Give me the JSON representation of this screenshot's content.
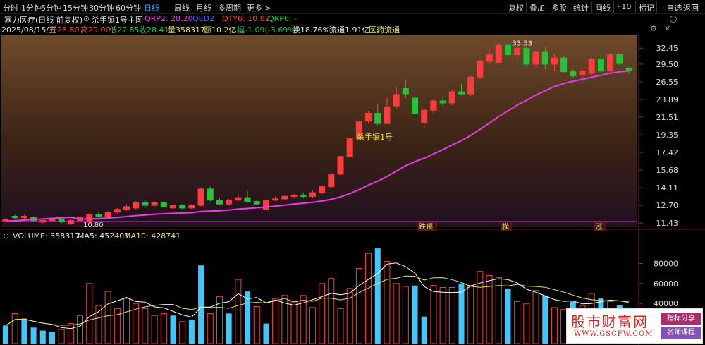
{
  "toolbar": {
    "periods": [
      {
        "label": "分时",
        "active": false
      },
      {
        "label": "1分钟",
        "active": false
      },
      {
        "label": "5分钟",
        "active": false
      },
      {
        "label": "15分钟",
        "active": false
      },
      {
        "label": "30分钟",
        "active": false
      },
      {
        "label": "60分钟",
        "active": false
      },
      {
        "label": "日线",
        "active": true
      },
      {
        "label": "周线",
        "active": false
      },
      {
        "label": "月线",
        "active": false
      },
      {
        "label": "多周期",
        "active": false
      },
      {
        "label": "更多 >",
        "active": false
      }
    ],
    "right_buttons": [
      "复权",
      "叠加",
      "多股",
      "统计",
      "画线",
      "F10",
      "标记",
      "+自选",
      "返回"
    ]
  },
  "header": {
    "stock_name": "塞力医疗(日线 前复权)",
    "indicator": "杀手锏1号主图",
    "qrp2_label": "QRP2: 28.20",
    "qed2_label": "QED2",
    "qty6_label": "QTY6: 10.82",
    "qrp6_label": "QRP6: -",
    "date": "2025/08/15/五",
    "open": "开28.80",
    "high": "高29.00",
    "low": "低27.85",
    "close": "收28.41",
    "volume": "量358317",
    "amount": "额10.2亿",
    "change": "幅-1.09(-3.69%)",
    "turnover": "换18.76%",
    "float": "流通1.91亿",
    "sector": "医药流通"
  },
  "colors": {
    "up": "#ff3b3b",
    "down": "#3fc8ff",
    "green_candle": "#22c43a",
    "ma_line": "#e63ce6",
    "ma5": "#ffffff",
    "ma10": "#e8e060"
  },
  "chart_data": {
    "type": "candlestick",
    "price_axis_ticks": [
      "32.45",
      "29.50",
      "26.55",
      "23.89",
      "21.51",
      "19.35",
      "17.42",
      "15.68",
      "14.11",
      "12.70",
      "11.43"
    ],
    "annotation_high": "33.53",
    "annotation_low": "10.80",
    "signal_label": "杀手锏1号",
    "bottom_markers": [
      "跌预",
      "横",
      "涨"
    ],
    "candles": [
      {
        "o": 11.6,
        "c": 11.7,
        "h": 11.8,
        "l": 11.5
      },
      {
        "o": 11.9,
        "c": 11.8,
        "h": 12.0,
        "l": 11.7
      },
      {
        "o": 11.8,
        "c": 11.9,
        "h": 12.0,
        "l": 11.7
      },
      {
        "o": 11.8,
        "c": 11.6,
        "h": 11.9,
        "l": 11.5
      },
      {
        "o": 11.5,
        "c": 11.6,
        "h": 11.7,
        "l": 11.4
      },
      {
        "o": 11.6,
        "c": 11.7,
        "h": 11.8,
        "l": 11.5
      },
      {
        "o": 11.7,
        "c": 11.5,
        "h": 11.8,
        "l": 11.4
      },
      {
        "o": 11.4,
        "c": 11.6,
        "h": 11.7,
        "l": 11.3
      },
      {
        "o": 11.6,
        "c": 11.8,
        "h": 11.9,
        "l": 11.5
      },
      {
        "o": 11.5,
        "c": 12.0,
        "h": 12.1,
        "l": 11.4
      },
      {
        "o": 12.0,
        "c": 11.9,
        "h": 12.2,
        "l": 11.8
      },
      {
        "o": 11.9,
        "c": 12.2,
        "h": 12.3,
        "l": 11.8
      },
      {
        "o": 12.2,
        "c": 12.4,
        "h": 12.5,
        "l": 12.1
      },
      {
        "o": 12.4,
        "c": 12.6,
        "h": 12.8,
        "l": 12.3
      },
      {
        "o": 12.5,
        "c": 12.9,
        "h": 13.0,
        "l": 12.4
      },
      {
        "o": 12.9,
        "c": 12.7,
        "h": 13.1,
        "l": 12.5
      },
      {
        "o": 12.7,
        "c": 12.9,
        "h": 13.0,
        "l": 12.6
      },
      {
        "o": 12.9,
        "c": 12.6,
        "h": 13.0,
        "l": 12.5
      },
      {
        "o": 12.5,
        "c": 12.7,
        "h": 12.8,
        "l": 12.4
      },
      {
        "o": 12.7,
        "c": 12.5,
        "h": 12.8,
        "l": 12.4
      },
      {
        "o": 12.5,
        "c": 12.7,
        "h": 12.8,
        "l": 12.4
      },
      {
        "o": 12.7,
        "c": 14.0,
        "h": 14.1,
        "l": 12.6
      },
      {
        "o": 14.0,
        "c": 13.1,
        "h": 14.2,
        "l": 13.0
      },
      {
        "o": 13.1,
        "c": 12.8,
        "h": 13.3,
        "l": 12.7
      },
      {
        "o": 12.8,
        "c": 13.1,
        "h": 13.2,
        "l": 12.7
      },
      {
        "o": 13.1,
        "c": 13.3,
        "h": 13.6,
        "l": 13.0
      },
      {
        "o": 13.3,
        "c": 13.0,
        "h": 13.8,
        "l": 12.9
      },
      {
        "o": 13.0,
        "c": 12.8,
        "h": 13.1,
        "l": 12.7
      },
      {
        "o": 12.4,
        "c": 13.1,
        "h": 13.2,
        "l": 12.2
      },
      {
        "o": 13.1,
        "c": 13.2,
        "h": 13.4,
        "l": 13.0
      },
      {
        "o": 13.2,
        "c": 13.4,
        "h": 13.5,
        "l": 13.1
      },
      {
        "o": 13.4,
        "c": 13.5,
        "h": 13.6,
        "l": 13.3
      },
      {
        "o": 13.5,
        "c": 13.4,
        "h": 13.7,
        "l": 13.3
      },
      {
        "o": 13.4,
        "c": 13.7,
        "h": 13.9,
        "l": 13.3
      },
      {
        "o": 13.7,
        "c": 14.2,
        "h": 14.3,
        "l": 13.6
      },
      {
        "o": 14.2,
        "c": 15.3,
        "h": 15.4,
        "l": 14.1
      },
      {
        "o": 15.3,
        "c": 17.0,
        "h": 17.1,
        "l": 15.2
      },
      {
        "o": 17.0,
        "c": 18.9,
        "h": 19.0,
        "l": 16.9
      },
      {
        "o": 18.9,
        "c": 20.9,
        "h": 21.0,
        "l": 18.8
      },
      {
        "o": 21.0,
        "c": 22.0,
        "h": 22.3,
        "l": 20.7
      },
      {
        "o": 22.0,
        "c": 20.7,
        "h": 23.2,
        "l": 20.5
      },
      {
        "o": 20.7,
        "c": 22.8,
        "h": 24.2,
        "l": 20.6
      },
      {
        "o": 23.0,
        "c": 24.6,
        "h": 25.8,
        "l": 22.6
      },
      {
        "o": 25.5,
        "c": 24.7,
        "h": 26.9,
        "l": 24.1
      },
      {
        "o": 24.1,
        "c": 22.0,
        "h": 24.3,
        "l": 21.8
      },
      {
        "o": 20.8,
        "c": 22.4,
        "h": 22.7,
        "l": 20.1
      },
      {
        "o": 22.4,
        "c": 23.7,
        "h": 24.0,
        "l": 22.0
      },
      {
        "o": 23.7,
        "c": 23.4,
        "h": 24.5,
        "l": 23.0
      },
      {
        "o": 23.4,
        "c": 25.0,
        "h": 25.3,
        "l": 23.1
      },
      {
        "o": 25.0,
        "c": 24.7,
        "h": 26.2,
        "l": 24.5
      },
      {
        "o": 24.7,
        "c": 27.3,
        "h": 27.6,
        "l": 24.4
      },
      {
        "o": 27.3,
        "c": 30.0,
        "h": 30.3,
        "l": 27.0
      },
      {
        "o": 30.0,
        "c": 31.2,
        "h": 32.4,
        "l": 29.5
      },
      {
        "o": 29.7,
        "c": 33.0,
        "h": 33.4,
        "l": 29.4
      },
      {
        "o": 33.0,
        "c": 31.2,
        "h": 33.53,
        "l": 30.8
      },
      {
        "o": 31.2,
        "c": 32.4,
        "h": 32.8,
        "l": 30.0
      },
      {
        "o": 32.4,
        "c": 29.5,
        "h": 32.7,
        "l": 29.0
      },
      {
        "o": 29.5,
        "c": 31.8,
        "h": 32.0,
        "l": 28.9
      },
      {
        "o": 31.8,
        "c": 29.5,
        "h": 32.6,
        "l": 28.6
      },
      {
        "o": 29.5,
        "c": 30.6,
        "h": 31.4,
        "l": 28.3
      },
      {
        "o": 30.6,
        "c": 28.2,
        "h": 30.9,
        "l": 27.9
      },
      {
        "o": 28.2,
        "c": 27.5,
        "h": 28.6,
        "l": 27.2
      },
      {
        "o": 27.7,
        "c": 28.3,
        "h": 28.8,
        "l": 26.6
      },
      {
        "o": 27.9,
        "c": 30.4,
        "h": 30.7,
        "l": 27.6
      },
      {
        "o": 30.4,
        "c": 28.3,
        "h": 31.8,
        "l": 28.0
      },
      {
        "o": 28.3,
        "c": 31.2,
        "h": 31.5,
        "l": 28.1
      },
      {
        "o": 31.2,
        "c": 29.6,
        "h": 31.5,
        "l": 29.3
      },
      {
        "o": 28.8,
        "c": 28.41,
        "h": 29.0,
        "l": 27.85
      }
    ],
    "volume_header": {
      "label": "VOLUME: 358317",
      "ma5": "MA5: 452401",
      "ma10": "MA10: 428741"
    },
    "volume_axis_ticks": [
      "80000",
      "60000",
      "40000"
    ],
    "volumes": [
      {
        "v": 18000,
        "up": false
      },
      {
        "v": 30000,
        "up": true
      },
      {
        "v": 25000,
        "up": false
      },
      {
        "v": 16000,
        "up": false
      },
      {
        "v": 13000,
        "up": false
      },
      {
        "v": 12000,
        "up": false
      },
      {
        "v": 14000,
        "up": true
      },
      {
        "v": 20000,
        "up": true
      },
      {
        "v": 28000,
        "up": true
      },
      {
        "v": 60000,
        "up": true
      },
      {
        "v": 38000,
        "up": true
      },
      {
        "v": 52000,
        "up": true
      },
      {
        "v": 35000,
        "up": true
      },
      {
        "v": 45000,
        "up": true
      },
      {
        "v": 40000,
        "up": true
      },
      {
        "v": 35000,
        "up": true
      },
      {
        "v": 28000,
        "up": true
      },
      {
        "v": 30000,
        "up": true
      },
      {
        "v": 28000,
        "up": false
      },
      {
        "v": 22000,
        "up": true
      },
      {
        "v": 24000,
        "up": false
      },
      {
        "v": 78000,
        "up": false
      },
      {
        "v": 30000,
        "up": true
      },
      {
        "v": 47000,
        "up": true
      },
      {
        "v": 30000,
        "up": false
      },
      {
        "v": 64000,
        "up": true
      },
      {
        "v": 52000,
        "up": false
      },
      {
        "v": 37000,
        "up": true
      },
      {
        "v": 20000,
        "up": false
      },
      {
        "v": 45000,
        "up": true
      },
      {
        "v": 48000,
        "up": true
      },
      {
        "v": 42000,
        "up": true
      },
      {
        "v": 48000,
        "up": true
      },
      {
        "v": 36000,
        "up": true
      },
      {
        "v": 60000,
        "up": true
      },
      {
        "v": 65000,
        "up": true
      },
      {
        "v": 35000,
        "up": true
      },
      {
        "v": 55000,
        "up": true
      },
      {
        "v": 75000,
        "up": true
      },
      {
        "v": 90000,
        "up": true
      },
      {
        "v": 95000,
        "up": false
      },
      {
        "v": 82000,
        "up": true
      },
      {
        "v": 60000,
        "up": true
      },
      {
        "v": 57000,
        "up": true
      },
      {
        "v": 58000,
        "up": false
      },
      {
        "v": 27000,
        "up": false
      },
      {
        "v": 58000,
        "up": true
      },
      {
        "v": 56000,
        "up": true
      },
      {
        "v": 56000,
        "up": true
      },
      {
        "v": 60000,
        "up": false
      },
      {
        "v": 58000,
        "up": true
      },
      {
        "v": 72000,
        "up": true
      },
      {
        "v": 68000,
        "up": true
      },
      {
        "v": 66000,
        "up": true
      },
      {
        "v": 55000,
        "up": false
      },
      {
        "v": 42000,
        "up": true
      },
      {
        "v": 40000,
        "up": true
      },
      {
        "v": 53000,
        "up": true
      },
      {
        "v": 48000,
        "up": false
      },
      {
        "v": 36000,
        "up": true
      },
      {
        "v": 34000,
        "up": true
      },
      {
        "v": 42000,
        "up": false
      },
      {
        "v": 38000,
        "up": true
      },
      {
        "v": 50000,
        "up": true
      },
      {
        "v": 45000,
        "up": false
      },
      {
        "v": 42000,
        "up": true
      },
      {
        "v": 38000,
        "up": false
      },
      {
        "v": 36000,
        "up": false
      }
    ]
  },
  "watermark": {
    "title": "股市财富网",
    "url": "WWW.GSCFW.COM",
    "tag1": "指标分享",
    "tag2": "名师课程"
  }
}
